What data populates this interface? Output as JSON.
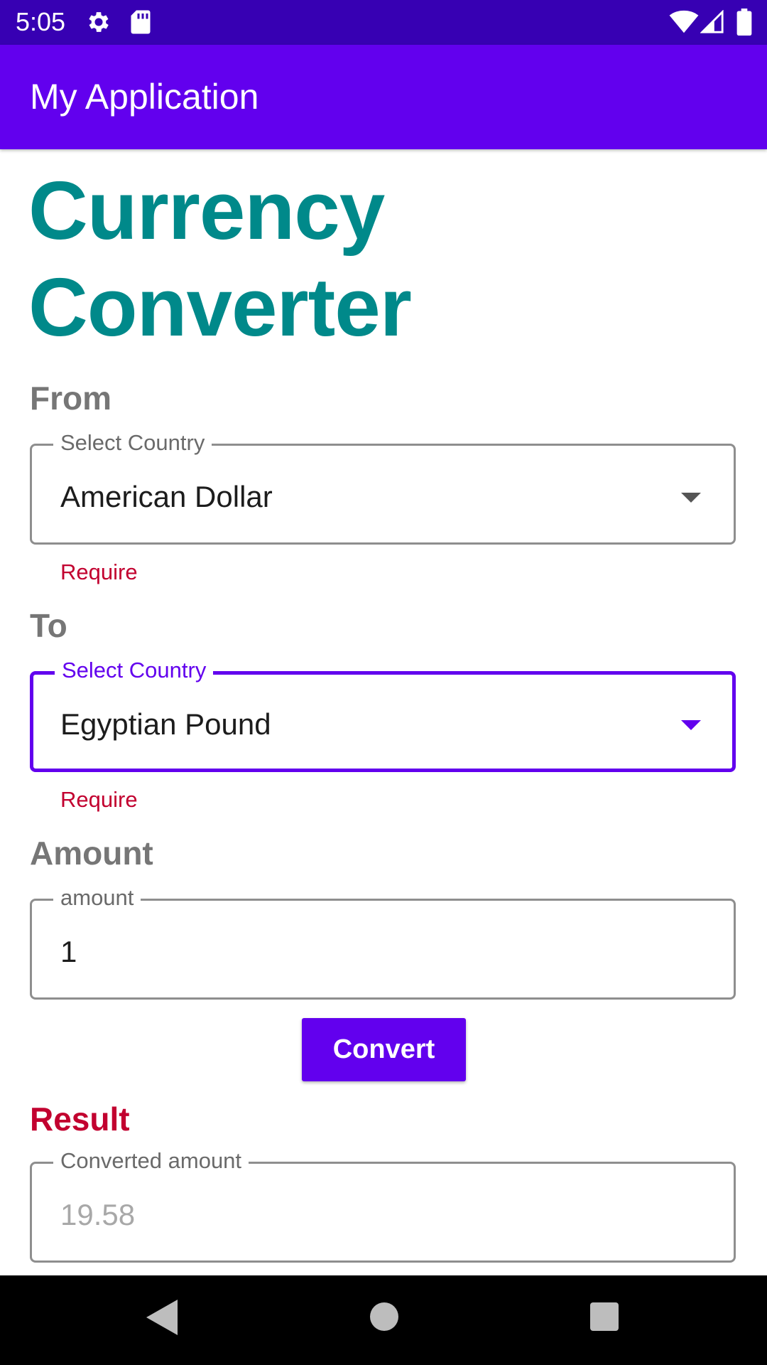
{
  "status_bar": {
    "time": "5:05",
    "icons": [
      "gear-icon",
      "sd-card-icon",
      "wifi-icon",
      "signal-icon",
      "battery-icon"
    ]
  },
  "app_bar": {
    "title": "My Application"
  },
  "page": {
    "title_line1": "Currency",
    "title_line2": "Converter"
  },
  "from": {
    "section_label": "From",
    "field_label": "Select Country",
    "value": "American Dollar",
    "helper": "Require"
  },
  "to": {
    "section_label": "To",
    "field_label": "Select Country",
    "value": "Egyptian Pound",
    "helper": "Require"
  },
  "amount": {
    "section_label": "Amount",
    "field_label": "amount",
    "value": "1"
  },
  "convert_button": {
    "label": "Convert"
  },
  "result": {
    "section_label": "Result",
    "field_label": "Converted amount",
    "value": "19.58"
  },
  "colors": {
    "status_bar": "#3700b3",
    "app_bar": "#6200ee",
    "title": "#00898a",
    "error": "#c2002f",
    "focused": "#6200ee"
  },
  "nav_bar": {
    "icons": [
      "back-icon",
      "home-icon",
      "recents-icon"
    ]
  }
}
